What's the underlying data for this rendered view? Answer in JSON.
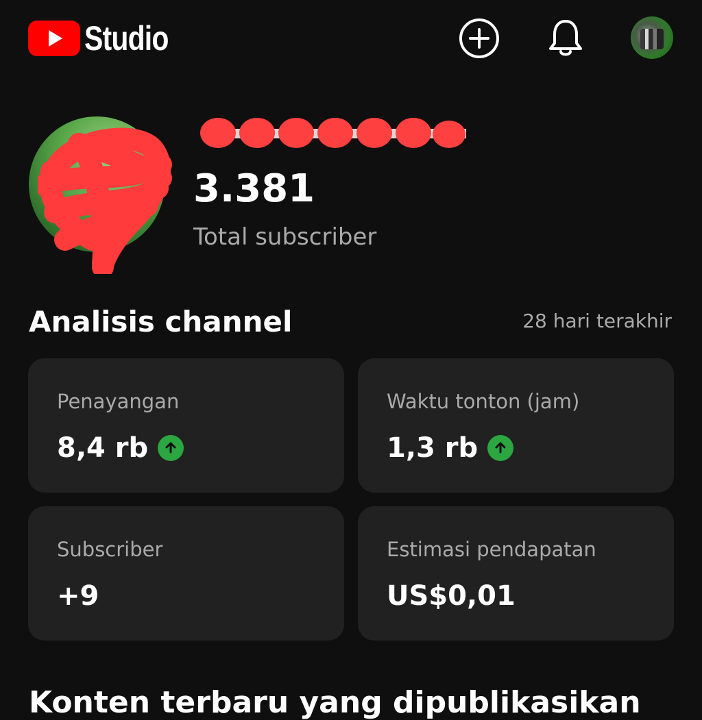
{
  "header": {
    "app_name": "Studio",
    "icons": [
      "create-icon",
      "notifications-icon",
      "account-avatar"
    ]
  },
  "channel": {
    "name": "",
    "subscriber_count": "3.381",
    "subscriber_label": "Total subscriber"
  },
  "analytics": {
    "title": "Analisis channel",
    "period": "28 hari terakhir",
    "cards": [
      {
        "label": "Penayangan",
        "value": "8,4 rb",
        "trend": "up"
      },
      {
        "label": "Waktu tonton (jam)",
        "value": "1,3 rb",
        "trend": "up"
      },
      {
        "label": "Subscriber",
        "value": "+9",
        "trend": "none"
      },
      {
        "label": "Estimasi pendapatan",
        "value": "US$0,01",
        "trend": "none"
      }
    ]
  },
  "next_section": {
    "title": "Konten terbaru yang dipublikasikan"
  },
  "colors": {
    "background": "#0f0f0f",
    "card": "#212121",
    "youtube_red": "#ff0000",
    "trend_up": "#2ba640",
    "secondary_text": "#aaaaaa"
  }
}
